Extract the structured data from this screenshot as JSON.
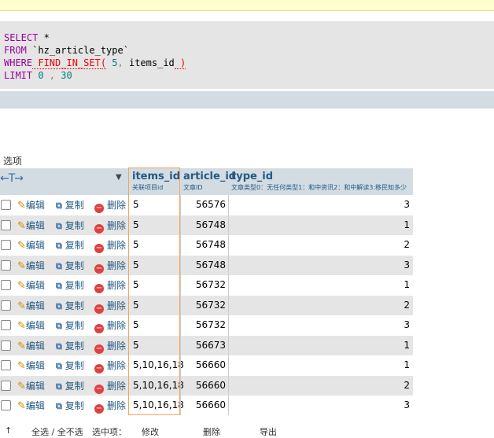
{
  "sql": {
    "line1_kw": "SELECT",
    "line1_rest": " *",
    "line2_kw": "FROM",
    "line2_table": " `hz_article_type`",
    "line3_kw": "WHERE",
    "line3_fn": " FIND_IN_SET",
    "line3_paren_open": "(",
    "line3_num": " 5",
    "line3_sep": ",",
    "line3_col": " items_id",
    "line3_paren_close": " )",
    "line4_kw": "LIMIT",
    "line4_n1": " 0",
    "line4_sep": " ,",
    "line4_n2": " 30"
  },
  "options_label": "选项",
  "columns": [
    {
      "name": "items_id",
      "comment": "关联项目id"
    },
    {
      "name": "article_id",
      "comment": "文章ID"
    },
    {
      "name": "type_id",
      "comment": "文章类型0：无任何类型1：和中资讯2：和中解读3:移民知多少"
    }
  ],
  "actions": {
    "edit": "编辑",
    "copy": "复制",
    "delete": "删除"
  },
  "rows": [
    {
      "items_id": "5",
      "article_id": "56576",
      "type_id": "3"
    },
    {
      "items_id": "5",
      "article_id": "56748",
      "type_id": "1"
    },
    {
      "items_id": "5",
      "article_id": "56748",
      "type_id": "2"
    },
    {
      "items_id": "5",
      "article_id": "56748",
      "type_id": "3"
    },
    {
      "items_id": "5",
      "article_id": "56732",
      "type_id": "1"
    },
    {
      "items_id": "5",
      "article_id": "56732",
      "type_id": "2"
    },
    {
      "items_id": "5",
      "article_id": "56732",
      "type_id": "3"
    },
    {
      "items_id": "5",
      "article_id": "56673",
      "type_id": "1"
    },
    {
      "items_id": "5,10,16,18",
      "article_id": "56660",
      "type_id": "1"
    },
    {
      "items_id": "5,10,16,18",
      "article_id": "56660",
      "type_id": "2"
    },
    {
      "items_id": "5,10,16,18",
      "article_id": "56660",
      "type_id": "3"
    }
  ],
  "footer": {
    "check_all": "全选 / 全不选",
    "with_selected": "选中项：",
    "edit": "修改",
    "delete": "删除",
    "export": "导出"
  }
}
